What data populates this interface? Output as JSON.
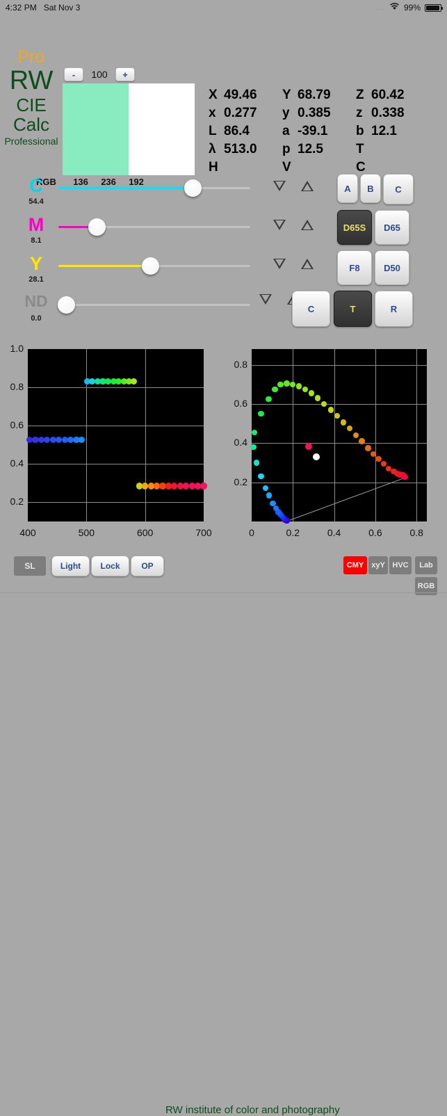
{
  "statusbar": {
    "time": "4:32 PM",
    "date": "Sat Nov 3",
    "signal_dots": "....",
    "wifi_icon": "wifi-icon",
    "battery_percent": "99%"
  },
  "brand": {
    "pro": "Pro",
    "rw": "RW",
    "cie": "CIE",
    "calc": "Calc",
    "professional": "Professional",
    "pro_color": "#f2a81c",
    "text_color": "#0d4d1a"
  },
  "stepper": {
    "minus_label": "-",
    "value": "100",
    "plus_label": "+"
  },
  "swatch": {
    "left_color": "#88ECC0",
    "right_color": "#ffffff"
  },
  "rgb": {
    "label": "RGB",
    "r": "136",
    "g": "236",
    "b": "192"
  },
  "readout": {
    "rows": [
      [
        {
          "k": "X",
          "v": "49.46"
        },
        {
          "k": "Y",
          "v": "68.79"
        },
        {
          "k": "Z",
          "v": "60.42"
        }
      ],
      [
        {
          "k": "x",
          "v": "0.277"
        },
        {
          "k": "y",
          "v": "0.385"
        },
        {
          "k": "z",
          "v": "0.338"
        }
      ],
      [
        {
          "k": "L",
          "v": "86.4"
        },
        {
          "k": "a",
          "v": "-39.1"
        },
        {
          "k": "b",
          "v": "12.1"
        }
      ],
      [
        {
          "k": "λ",
          "v": "513.0"
        },
        {
          "k": "p",
          "v": "12.5"
        },
        {
          "k": "T",
          "v": ""
        }
      ],
      [
        {
          "k": "H",
          "v": ""
        },
        {
          "k": "V",
          "v": ""
        },
        {
          "k": "C",
          "v": ""
        }
      ]
    ]
  },
  "sliders": [
    {
      "name": "C",
      "value": "54.4",
      "percent": 70,
      "color": "#00e5ff",
      "label_color": "#00d8f0"
    },
    {
      "name": "M",
      "value": "8.1",
      "percent": 20,
      "color": "#ff00c8",
      "label_color": "#ff00c8"
    },
    {
      "name": "Y",
      "value": "28.1",
      "percent": 48,
      "color": "#ffe800",
      "label_color": "#ffe800"
    },
    {
      "name": "ND",
      "value": "0.0",
      "percent": 4,
      "color": "#c8c8c8",
      "label_color": "#8a8a8a"
    }
  ],
  "arrow_rows": [
    {
      "down": "decrease-arrow",
      "up": "increase-arrow"
    },
    {
      "down": "decrease-arrow",
      "up": "increase-arrow"
    },
    {
      "down": "decrease-arrow",
      "up": "increase-arrow"
    },
    {
      "down": "decrease-arrow",
      "up": "increase-arrow"
    }
  ],
  "keypad": [
    {
      "label": "A",
      "selected": false
    },
    {
      "label": "B",
      "selected": false
    },
    {
      "label": "C",
      "selected": false
    },
    {
      "label": "D65S",
      "selected": true
    },
    {
      "label": "D65",
      "selected": false
    },
    {
      "label": "F8",
      "selected": false
    },
    {
      "label": "D50",
      "selected": false
    },
    {
      "label": "C",
      "selected": false
    },
    {
      "label": "T",
      "selected": true
    },
    {
      "label": "R",
      "selected": false
    }
  ],
  "bottom": {
    "sl": "SL",
    "light": "Light",
    "lock": "Lock",
    "op": "OP",
    "tagline": "RW institute of color and photography",
    "modes": [
      {
        "label": "CMY",
        "active": true
      },
      {
        "label": "xyY",
        "active": false
      },
      {
        "label": "HVC",
        "active": false
      },
      {
        "label": "Lab",
        "active": false
      },
      {
        "label": "RGB",
        "active": false
      }
    ]
  },
  "chart_data": [
    {
      "type": "scatter",
      "title": "",
      "xlabel": "",
      "ylabel": "",
      "xlim": [
        400,
        700
      ],
      "ylim": [
        0.1,
        1.0
      ],
      "xticks": [
        "400",
        "500",
        "600",
        "700"
      ],
      "xtickvals": [
        400,
        500,
        600,
        700
      ],
      "yticks": [
        "0.2",
        "0.4",
        "0.6",
        "0.8",
        "1.0"
      ],
      "ytickvals": [
        0.2,
        0.4,
        0.6,
        0.8,
        1.0
      ],
      "grid": true,
      "background": "#000000",
      "series": [
        {
          "name": "blue-band",
          "x": [
            403,
            413,
            423,
            433,
            443,
            453,
            463,
            473,
            483,
            492
          ],
          "y": [
            0.525,
            0.525,
            0.525,
            0.525,
            0.525,
            0.525,
            0.525,
            0.525,
            0.525,
            0.525
          ],
          "colors": [
            "#3a28e6",
            "#3630ea",
            "#3238ee",
            "#2e42f2",
            "#2a4cf5",
            "#2656f8",
            "#2260fa",
            "#1e6efc",
            "#1a7efd",
            "#1690fe"
          ]
        },
        {
          "name": "green-band",
          "x": [
            501,
            510,
            519,
            528,
            537,
            546,
            555,
            564,
            573,
            581
          ],
          "y": [
            0.83,
            0.83,
            0.83,
            0.83,
            0.83,
            0.83,
            0.83,
            0.83,
            0.83,
            0.83
          ],
          "colors": [
            "#1ab8f0",
            "#14d4d8",
            "#10e0a8",
            "#0ee878",
            "#10ee4c",
            "#18f032",
            "#2cf024",
            "#50ee22",
            "#78ec20",
            "#a8e818"
          ]
        },
        {
          "name": "red-band",
          "x": [
            590,
            600,
            610,
            620,
            630,
            640,
            650,
            660,
            670,
            680,
            690,
            700
          ],
          "y": [
            0.285,
            0.285,
            0.285,
            0.285,
            0.285,
            0.285,
            0.285,
            0.285,
            0.285,
            0.285,
            0.285,
            0.285
          ],
          "colors": [
            "#c8d414",
            "#f0a814",
            "#fa8a10",
            "#fa6a0e",
            "#f4400e",
            "#f02218",
            "#ef1430",
            "#ee1440",
            "#ee1450",
            "#ef1458",
            "#f01460",
            "#f21468"
          ]
        }
      ]
    },
    {
      "type": "scatter",
      "title": "",
      "xlabel": "",
      "ylabel": "",
      "xlim": [
        0.0,
        0.85
      ],
      "ylim": [
        0.0,
        0.88
      ],
      "xticks": [
        "0",
        "0.2",
        "0.4",
        "0.6",
        "0.8"
      ],
      "xtickvals": [
        0.0,
        0.2,
        0.4,
        0.6,
        0.8
      ],
      "yticks": [
        "0.2",
        "0.4",
        "0.6",
        "0.8"
      ],
      "ytickvals": [
        0.2,
        0.4,
        0.6,
        0.8
      ],
      "grid": true,
      "background": "#000000",
      "series": [
        {
          "name": "spectral-locus",
          "x": [
            0.173,
            0.168,
            0.164,
            0.16,
            0.155,
            0.148,
            0.14,
            0.13,
            0.118,
            0.103,
            0.085,
            0.068,
            0.045,
            0.023,
            0.008,
            0.013,
            0.045,
            0.082,
            0.113,
            0.14,
            0.17,
            0.2,
            0.23,
            0.26,
            0.29,
            0.32,
            0.35,
            0.385,
            0.415,
            0.445,
            0.475,
            0.505,
            0.535,
            0.565,
            0.59,
            0.615,
            0.64,
            0.665,
            0.69,
            0.705,
            0.718,
            0.728,
            0.733,
            0.736,
            0.738,
            0.74,
            0.742,
            0.744
          ],
          "y": [
            0.005,
            0.005,
            0.008,
            0.011,
            0.017,
            0.025,
            0.035,
            0.048,
            0.068,
            0.093,
            0.133,
            0.17,
            0.23,
            0.3,
            0.38,
            0.455,
            0.55,
            0.625,
            0.675,
            0.7,
            0.705,
            0.7,
            0.69,
            0.675,
            0.655,
            0.63,
            0.6,
            0.57,
            0.54,
            0.505,
            0.475,
            0.44,
            0.41,
            0.375,
            0.345,
            0.32,
            0.295,
            0.27,
            0.255,
            0.245,
            0.24,
            0.238,
            0.236,
            0.234,
            0.232,
            0.23,
            0.228,
            0.226
          ],
          "colors": [
            "#3000d0",
            "#3400d8",
            "#3800e0",
            "#2a10e8",
            "#2020f0",
            "#1a34f4",
            "#1848f8",
            "#1860fa",
            "#1878fc",
            "#1890fd",
            "#18a8fe",
            "#18c0fe",
            "#14d8f4",
            "#10e4c8",
            "#0eeaa0",
            "#10ee74",
            "#16f048",
            "#22f030",
            "#38ef26",
            "#50ee22",
            "#62ec20",
            "#74ea1e",
            "#86e81c",
            "#94e61c",
            "#a2e41a",
            "#b0e018",
            "#bcdc16",
            "#c6d614",
            "#ccc814",
            "#d2b814",
            "#d8a614",
            "#de9212",
            "#e28010",
            "#e66c10",
            "#ea580e",
            "#ed480e",
            "#ef3a12",
            "#f02c18",
            "#f12020",
            "#f21824",
            "#f21428",
            "#f3122c",
            "#f31030",
            "#f40e32",
            "#f40c34",
            "#f50a36",
            "#f50838",
            "#f6063a"
          ]
        },
        {
          "name": "sample-point",
          "x": [
            0.277
          ],
          "y": [
            0.385
          ],
          "colors": [
            "#f21450"
          ]
        },
        {
          "name": "white-point",
          "x": [
            0.3127
          ],
          "y": [
            0.329
          ],
          "colors": [
            "#ffffff"
          ]
        }
      ],
      "annotations": [
        "purple-line from (0.173,0.005) to (0.744,0.226)"
      ]
    }
  ]
}
